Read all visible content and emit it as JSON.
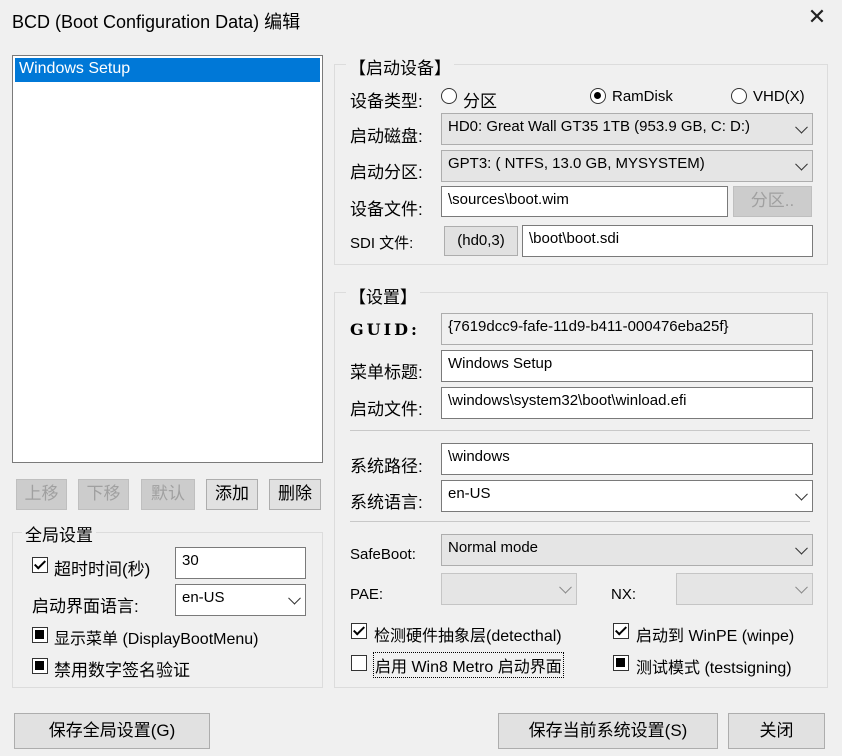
{
  "window": {
    "title": "BCD (Boot Configuration Data) 编辑"
  },
  "list": {
    "items": [
      "Windows Setup"
    ]
  },
  "list_buttons": {
    "up": "上移",
    "down": "下移",
    "default": "默认",
    "add": "添加",
    "delete": "删除"
  },
  "global": {
    "title": "全局设置",
    "timeout_label": "超时时间(秒)",
    "timeout_value": "30",
    "lang_label": "启动界面语言:",
    "lang_value": "en-US",
    "show_menu_label": "显示菜单 (DisplayBootMenu)",
    "disable_sig_label": "禁用数字签名验证"
  },
  "boot_device": {
    "title": "【启动设备】",
    "type_label": "设备类型:",
    "type_partition": "分区",
    "type_ramdisk": "RamDisk",
    "type_vhd": "VHD(X)",
    "disk_label": "启动磁盘:",
    "disk_value": "HD0: Great Wall GT35 1TB (953.9 GB, C: D:)",
    "part_label": "启动分区:",
    "part_value": "GPT3: ( NTFS,  13.0 GB, MYSYSTEM)",
    "file_label": "设备文件:",
    "file_value": "\\sources\\boot.wim",
    "part_button": "分区..",
    "sdi_label": "SDI 文件:",
    "sdi_button": "(hd0,3)",
    "sdi_value": "\\boot\\boot.sdi"
  },
  "settings": {
    "title": "【设置】",
    "guid_label": "GUID:",
    "guid_value": "{7619dcc9-fafe-11d9-b411-000476eba25f}",
    "menu_title_label": "菜单标题:",
    "menu_title_value": "Windows Setup",
    "boot_file_label": "启动文件:",
    "boot_file_value": "\\windows\\system32\\boot\\winload.efi",
    "sys_path_label": "系统路径:",
    "sys_path_value": "\\windows",
    "sys_lang_label": "系统语言:",
    "sys_lang_value": "en-US",
    "safeboot_label": "SafeBoot:",
    "safeboot_value": "Normal mode",
    "pae_label": "PAE:",
    "nx_label": "NX:",
    "detecthal_label": "检测硬件抽象层(detecthal)",
    "winpe_label": "启动到 WinPE (winpe)",
    "metro_label": "启用 Win8 Metro 启动界面",
    "testsigning_label": "测试模式 (testsigning)"
  },
  "footer": {
    "save_global": "保存全局设置(G)",
    "save_current": "保存当前系统设置(S)",
    "close": "关闭"
  },
  "colors": {
    "selection": "#0078d7",
    "background": "#f0f0f0"
  }
}
